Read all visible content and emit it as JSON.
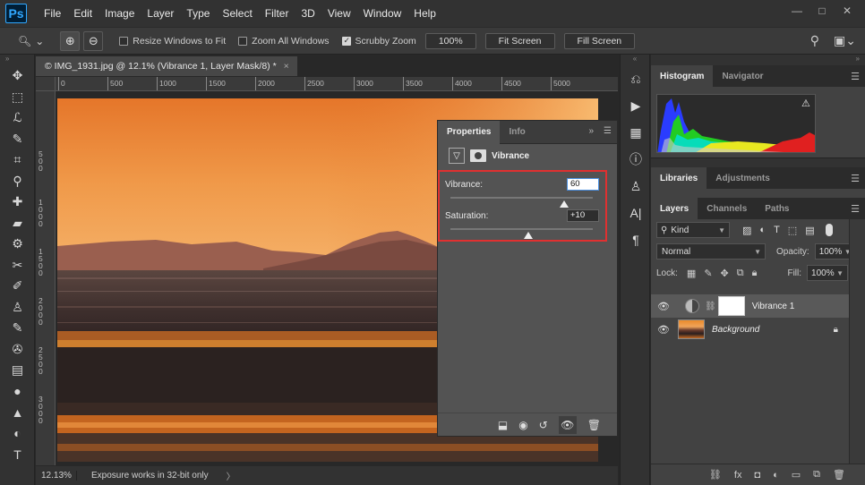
{
  "app": {
    "logo": "Ps",
    "menu": [
      "File",
      "Edit",
      "Image",
      "Layer",
      "Type",
      "Select",
      "Filter",
      "3D",
      "View",
      "Window",
      "Help"
    ],
    "window_controls": [
      "—",
      "□",
      "✕"
    ]
  },
  "options_bar": {
    "resize_windows_label": "Resize Windows to Fit",
    "resize_windows_checked": false,
    "zoom_all_label": "Zoom All Windows",
    "zoom_all_checked": false,
    "scrubby_label": "Scrubby Zoom",
    "scrubby_checked": true,
    "zoom_value": "100%",
    "fit_screen_label": "Fit Screen",
    "fill_screen_label": "Fill Screen"
  },
  "document": {
    "tab_title": "© IMG_1931.jpg @ 12.1% (Vibrance 1, Layer Mask/8) *",
    "tab_close": "×",
    "ruler_top": [
      "0",
      "500",
      "1000",
      "1500",
      "2000",
      "2500",
      "3000",
      "3500",
      "4000",
      "4500",
      "5000"
    ],
    "ruler_left": [
      "5\n0\n0",
      "1\n0\n0\n0",
      "1\n5\n0\n0",
      "2\n0\n0\n0",
      "2\n5\n0\n0",
      "3\n0\n0\n0"
    ]
  },
  "status": {
    "zoom": "12.13%",
    "info": "Exposure works in 32-bit only",
    "arrow": "〉"
  },
  "properties": {
    "tabs": [
      "Properties",
      "Info"
    ],
    "active_tab": "Properties",
    "adjustment_title": "Vibrance",
    "vibrance_label": "Vibrance:",
    "vibrance_value": "60",
    "vibrance_position": 0.8,
    "saturation_label": "Saturation:",
    "saturation_value": "+10",
    "saturation_position": 0.55
  },
  "histogram_panel": {
    "tabs": [
      "Histogram",
      "Navigator"
    ],
    "active_tab": "Histogram",
    "warning": "⚠"
  },
  "libraries_panel": {
    "tabs": [
      "Libraries",
      "Adjustments"
    ],
    "active_tab": "Libraries"
  },
  "layers_panel": {
    "tabs": [
      "Layers",
      "Channels",
      "Paths"
    ],
    "active_tab": "Layers",
    "kind_label": "Kind",
    "blend_mode": "Normal",
    "opacity_label": "Opacity:",
    "opacity_value": "100%",
    "lock_label": "Lock:",
    "fill_label": "Fill:",
    "fill_value": "100%",
    "layers": [
      {
        "name": "Vibrance 1",
        "selected": true
      },
      {
        "name": "Background",
        "selected": false,
        "locked": true
      }
    ]
  },
  "colors": {
    "highlight": "#e03030",
    "panel_bg": "#535353",
    "app_bg": "#282828"
  }
}
